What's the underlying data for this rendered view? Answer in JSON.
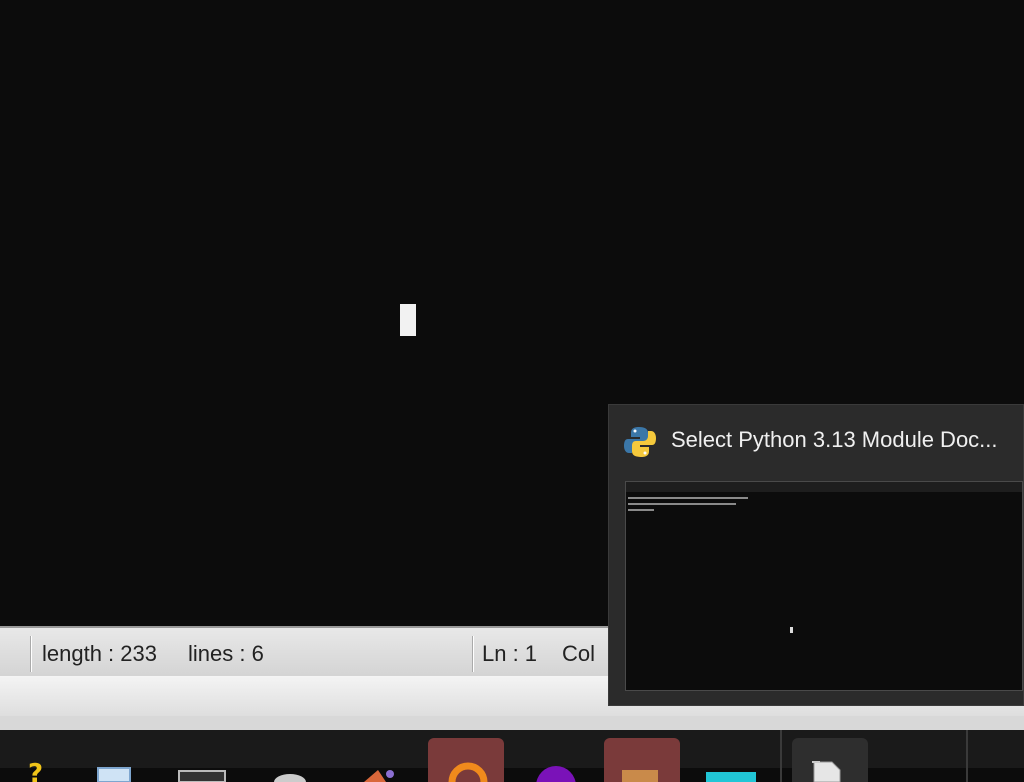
{
  "statusbar": {
    "length": "length : 233",
    "lines": "lines : 6",
    "ln": "Ln : 1",
    "col": "Col"
  },
  "taskbar_preview": {
    "title": "Select Python 3.13 Module Doc...",
    "icon": "python-icon"
  },
  "taskbar": {
    "items": [
      {
        "icon": "help-icon"
      },
      {
        "icon": "notepad-icon"
      },
      {
        "icon": "terminal-icon"
      },
      {
        "icon": "recycle-icon"
      },
      {
        "icon": "media-icon"
      },
      {
        "icon": "orange-app-icon"
      },
      {
        "icon": "purple-app-icon"
      },
      {
        "icon": "folder-icon"
      },
      {
        "icon": "cyan-app-icon"
      },
      {
        "icon": "document-icon"
      }
    ]
  }
}
